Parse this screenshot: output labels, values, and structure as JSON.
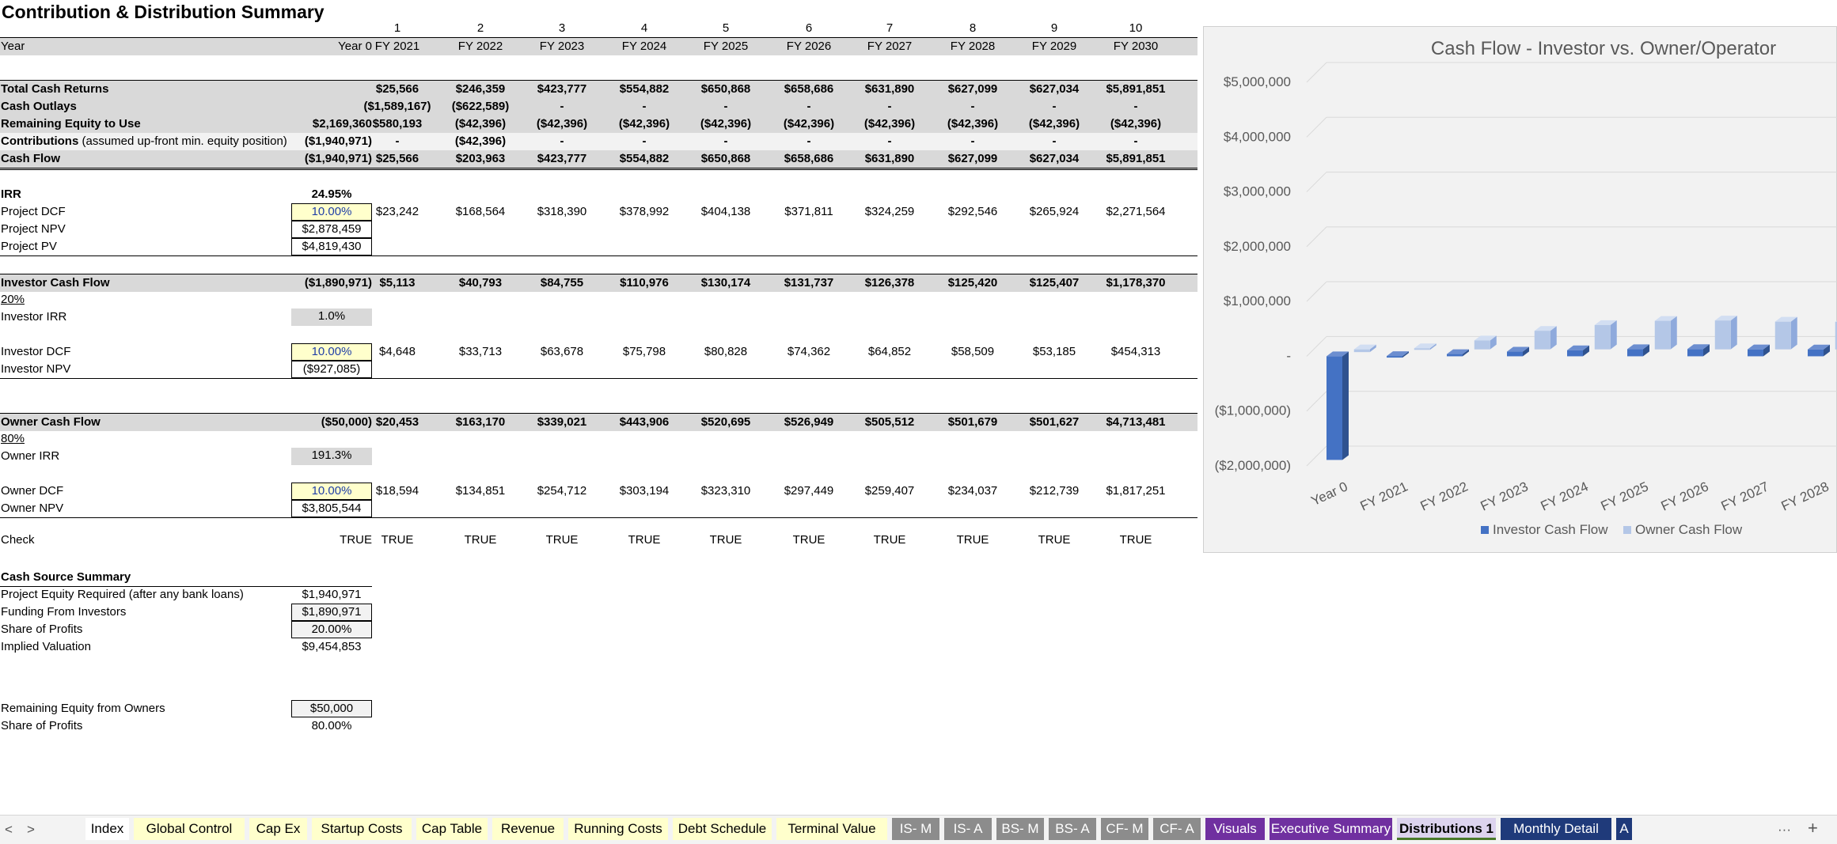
{
  "title": "Contribution & Distribution Summary",
  "period_numbers": [
    "1",
    "2",
    "3",
    "4",
    "5",
    "6",
    "7",
    "8",
    "9",
    "10"
  ],
  "year_row": {
    "label": "Year",
    "values": [
      "Year 0",
      "FY 2021",
      "FY 2022",
      "FY 2023",
      "FY 2024",
      "FY 2025",
      "FY 2026",
      "FY 2027",
      "FY 2028",
      "FY 2029",
      "FY 2030"
    ]
  },
  "returns_block": [
    {
      "label": "Total Cash Returns",
      "values": [
        "",
        "$25,566",
        "$246,359",
        "$423,777",
        "$554,882",
        "$650,868",
        "$658,686",
        "$631,890",
        "$627,099",
        "$627,034",
        "$5,891,851"
      ]
    },
    {
      "label": "Cash Outlays",
      "values": [
        "",
        "($1,589,167)",
        "($622,589)",
        "-",
        "-",
        "-",
        "-",
        "-",
        "-",
        "-",
        "-"
      ]
    },
    {
      "label": "Remaining Equity to Use",
      "values": [
        "$2,169,360",
        "$580,193",
        "($42,396)",
        "($42,396)",
        "($42,396)",
        "($42,396)",
        "($42,396)",
        "($42,396)",
        "($42,396)",
        "($42,396)",
        "($42,396)"
      ]
    },
    {
      "label": "Contributions",
      "label_note": " (assumed up-front min. equity position)",
      "values": [
        "($1,940,971)",
        "-",
        "($42,396)",
        "-",
        "-",
        "-",
        "-",
        "-",
        "-",
        "-",
        "-"
      ]
    },
    {
      "label": "Cash Flow",
      "values": [
        "($1,940,971)",
        "$25,566",
        "$203,963",
        "$423,777",
        "$554,882",
        "$650,868",
        "$658,686",
        "$631,890",
        "$627,099",
        "$627,034",
        "$5,891,851"
      ]
    }
  ],
  "project": {
    "irr_label": "IRR",
    "irr_value": "24.95%",
    "dcf_label": "Project DCF",
    "dcf_rate": "10.00%",
    "dcf_values": [
      "$23,242",
      "$168,564",
      "$318,390",
      "$378,992",
      "$404,138",
      "$371,811",
      "$324,259",
      "$292,546",
      "$265,924",
      "$2,271,564"
    ],
    "npv_label": "Project NPV",
    "npv_value": "$2,878,459",
    "pv_label": "Project PV",
    "pv_value": "$4,819,430"
  },
  "investor": {
    "label": "Investor Cash Flow",
    "values": [
      "($1,890,971)",
      "$5,113",
      "$40,793",
      "$84,755",
      "$110,976",
      "$130,174",
      "$131,737",
      "$126,378",
      "$125,420",
      "$125,407",
      "$1,178,370"
    ],
    "share": "20%",
    "irr_label": "Investor IRR",
    "irr_value": "1.0%",
    "dcf_label": "Investor DCF",
    "dcf_rate": "10.00%",
    "dcf_values": [
      "$4,648",
      "$33,713",
      "$63,678",
      "$75,798",
      "$80,828",
      "$74,362",
      "$64,852",
      "$58,509",
      "$53,185",
      "$454,313"
    ],
    "npv_label": "Investor NPV",
    "npv_value": "($927,085)"
  },
  "owner": {
    "label": "Owner Cash Flow",
    "values": [
      "($50,000)",
      "$20,453",
      "$163,170",
      "$339,021",
      "$443,906",
      "$520,695",
      "$526,949",
      "$505,512",
      "$501,679",
      "$501,627",
      "$4,713,481"
    ],
    "share": "80%",
    "irr_label": "Owner IRR",
    "irr_value": "191.3%",
    "dcf_label": "Owner DCF",
    "dcf_rate": "10.00%",
    "dcf_values": [
      "$18,594",
      "$134,851",
      "$254,712",
      "$303,194",
      "$323,310",
      "$297,449",
      "$259,407",
      "$234,037",
      "$212,739",
      "$1,817,251"
    ],
    "npv_label": "Owner NPV",
    "npv_value": "$3,805,544"
  },
  "check": {
    "label": "Check",
    "values": [
      "TRUE",
      "TRUE",
      "TRUE",
      "TRUE",
      "TRUE",
      "TRUE",
      "TRUE",
      "TRUE",
      "TRUE",
      "TRUE",
      "TRUE"
    ]
  },
  "cash_source": {
    "heading": "Cash Source Summary",
    "rows": [
      {
        "label": "Project Equity Required (after any bank loans)",
        "value": "$1,940,971",
        "boxed": false
      },
      {
        "label": "Funding From Investors",
        "value": "$1,890,971",
        "boxed": true
      },
      {
        "label": "Share of Profits",
        "value": "20.00%",
        "boxed": true
      },
      {
        "label": "Implied Valuation",
        "value": "$9,454,853",
        "boxed": false
      }
    ],
    "owner_rows": [
      {
        "label": "Remaining Equity from Owners",
        "value": "$50,000",
        "boxed": true
      },
      {
        "label": "Share of Profits",
        "value": "80.00%",
        "boxed": false
      }
    ]
  },
  "chart_data": {
    "type": "bar",
    "title": "Cash Flow - Investor vs. Owner/Operator",
    "categories": [
      "Year 0",
      "FY 2021",
      "FY 2022",
      "FY 2023",
      "FY 2024",
      "FY 2025",
      "FY 2026",
      "FY 2027",
      "FY 2028"
    ],
    "series": [
      {
        "name": "Investor Cash Flow",
        "color": "#4472c4",
        "values": [
          -1890971,
          5113,
          40793,
          84755,
          110976,
          130174,
          131737,
          126378,
          125420
        ]
      },
      {
        "name": "Owner Cash Flow",
        "color": "#b4c7e7",
        "values": [
          -50000,
          20453,
          163170,
          339021,
          443906,
          520695,
          526949,
          505512,
          501679
        ]
      }
    ],
    "ylim": [
      -2000000,
      5000000
    ],
    "yticks": [
      5000000,
      4000000,
      3000000,
      2000000,
      1000000,
      0,
      -1000000,
      -2000000
    ],
    "ytick_labels": [
      "$5,000,000",
      "$4,000,000",
      "$3,000,000",
      "$2,000,000",
      "$1,000,000",
      "-",
      "($1,000,000)",
      "($2,000,000)"
    ],
    "grid": true,
    "legend": "bottom"
  },
  "tabs": {
    "prev": "<",
    "next": ">",
    "more": "···",
    "add": "+",
    "items": [
      {
        "label": "Index",
        "bg": "#ffffff",
        "fg": "#000000"
      },
      {
        "label": "Global Control",
        "bg": "#ffffcc",
        "fg": "#000000"
      },
      {
        "label": "Cap Ex",
        "bg": "#ffffcc",
        "fg": "#000000"
      },
      {
        "label": "Startup Costs",
        "bg": "#ffffcc",
        "fg": "#000000"
      },
      {
        "label": "Cap Table",
        "bg": "#ffffcc",
        "fg": "#000000"
      },
      {
        "label": "Revenue",
        "bg": "#ffffcc",
        "fg": "#000000"
      },
      {
        "label": "Running Costs",
        "bg": "#ffffcc",
        "fg": "#000000"
      },
      {
        "label": "Debt Schedule",
        "bg": "#ffffcc",
        "fg": "#000000"
      },
      {
        "label": "Terminal Value",
        "bg": "#ffffcc",
        "fg": "#000000"
      },
      {
        "label": "IS- M",
        "bg": "#8c8c8c",
        "fg": "#ffffff"
      },
      {
        "label": "IS- A",
        "bg": "#8c8c8c",
        "fg": "#ffffff"
      },
      {
        "label": "BS- M",
        "bg": "#8c8c8c",
        "fg": "#ffffff"
      },
      {
        "label": "BS- A",
        "bg": "#8c8c8c",
        "fg": "#ffffff"
      },
      {
        "label": "CF- M",
        "bg": "#8c8c8c",
        "fg": "#ffffff"
      },
      {
        "label": "CF- A",
        "bg": "#8c8c8c",
        "fg": "#ffffff"
      },
      {
        "label": "Visuals",
        "bg": "#7030a0",
        "fg": "#ffffff"
      },
      {
        "label": "Executive Summary",
        "bg": "#7030a0",
        "fg": "#ffffff"
      },
      {
        "label": "Distributions 1",
        "bg": "#dcd3ee",
        "fg": "#000000",
        "active": true
      },
      {
        "label": "Monthly Detail",
        "bg": "#1f3a7a",
        "fg": "#ffffff"
      },
      {
        "label": "A",
        "bg": "#1f3a7a",
        "fg": "#ffffff"
      }
    ]
  }
}
